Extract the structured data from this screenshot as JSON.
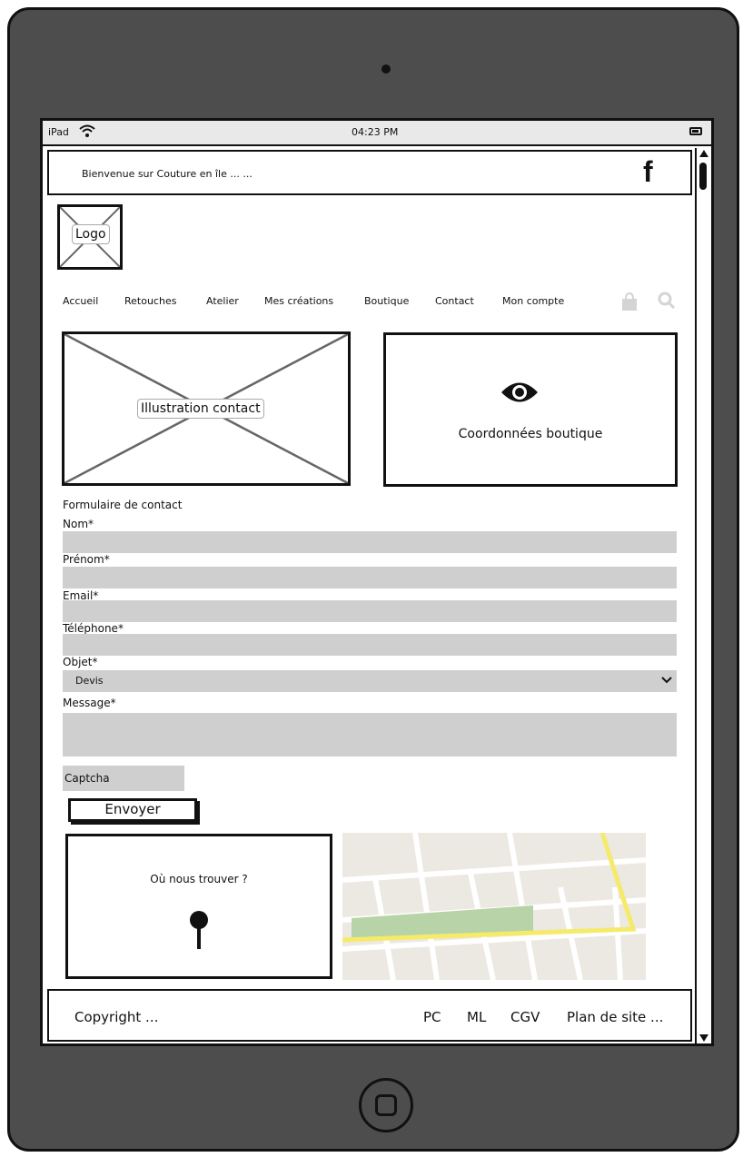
{
  "statusbar": {
    "carrier": "iPad",
    "time": "04:23 PM"
  },
  "header": {
    "welcome": "Bienvenue sur Couture en île ...     ...",
    "facebook_glyph": "f"
  },
  "logo": {
    "label": "Logo"
  },
  "nav": {
    "items": [
      "Accueil",
      "Retouches",
      "Atelier",
      "Mes créations",
      "Boutique",
      "Contact",
      "Mon compte"
    ]
  },
  "illustration": {
    "label": "Illustration contact"
  },
  "coordinates": {
    "label": "Coordonnées boutique"
  },
  "form": {
    "title": "Formulaire de contact",
    "nom_label": "Nom*",
    "prenom_label": "Prénom*",
    "email_label": "Email*",
    "telephone_label": "Téléphone*",
    "objet_label": "Objet*",
    "objet_value": "Devis",
    "message_label": "Message*",
    "captcha_label": "Captcha",
    "submit_label": "Envoyer"
  },
  "find_us": {
    "label": "Où nous trouver ?"
  },
  "footer": {
    "copyright": "Copyright     ...",
    "links": [
      "PC",
      "ML",
      "CGV",
      "Plan de site ..."
    ]
  },
  "icons": [
    "wifi-icon",
    "battery-icon",
    "facebook-icon",
    "shopping-bag-icon",
    "search-icon",
    "eye-icon",
    "chevron-down-icon",
    "map-pin-icon",
    "scroll-up-icon",
    "scroll-down-icon",
    "home-button-icon"
  ],
  "colors": {
    "device": "#4d4d4d",
    "field": "#cfcfcf",
    "map_road_main": "#f5ea6a",
    "map_park": "#b9d3a8",
    "map_bg": "#ece9e2"
  }
}
